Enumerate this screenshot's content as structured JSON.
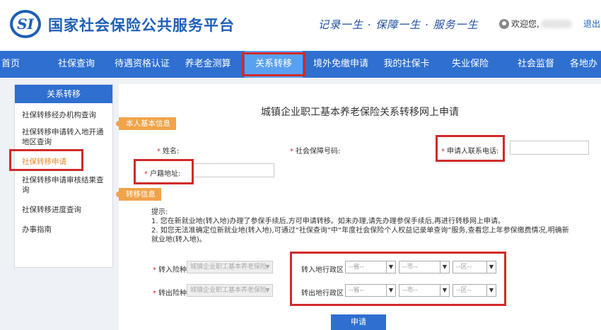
{
  "header": {
    "logo_text": "SI",
    "site_title": "国家社会保险公共服务平台",
    "slogan": "记录一生 · 保障一生 · 服务一生",
    "welcome": "欢迎您,",
    "logout": "退出"
  },
  "nav": {
    "items": [
      "首页",
      "社保查询",
      "待遇资格认证",
      "养老金测算",
      "关系转移",
      "境外免缴申请",
      "我的社保卡",
      "失业保险",
      "社会监督",
      "各地办"
    ],
    "active": "关系转移"
  },
  "sidebar": {
    "title": "关系转移",
    "items": [
      "社保转移经办机构查询",
      "社保转移申请转入地开通地区查询",
      "社保转移申请",
      "社保转移申请审核结果查询",
      "社保转移进度查询",
      "办事指南"
    ],
    "active": "社保转移申请"
  },
  "form": {
    "title": "城镇企业职工基本养老保险关系转移网上申请",
    "section_personal": "本人基本信息",
    "name_label": "姓名:",
    "ssn_label": "社会保障号码:",
    "phone_label": "申请人联系电话:",
    "address_label": "户籍地址:",
    "section_transfer": "转移信息",
    "tips_title": "提示:",
    "tip_1": "1. 您在新就业地(转入地)办理了参保手续后,方可申请转移。如未办理,请先办理参保手续后,再进行转移网上申请。",
    "tip_2": "2. 如您无法准确定位新就业地(转入地),可通过“社保查询”中“年度社会保险个人权益记录单查询”服务,查看您上年参保缴费情况,明确新就业地(转入地)。",
    "in_type_label": "转入险种",
    "out_type_label": "转出险种",
    "insurance_type_value": "城镇企业职工基本养老保险",
    "in_region_label": "转入地行政区",
    "out_region_label": "转出地行政区",
    "province_placeholder": "--省--",
    "city_placeholder": "--市--",
    "district_placeholder": "--区--",
    "submit": "申请"
  }
}
